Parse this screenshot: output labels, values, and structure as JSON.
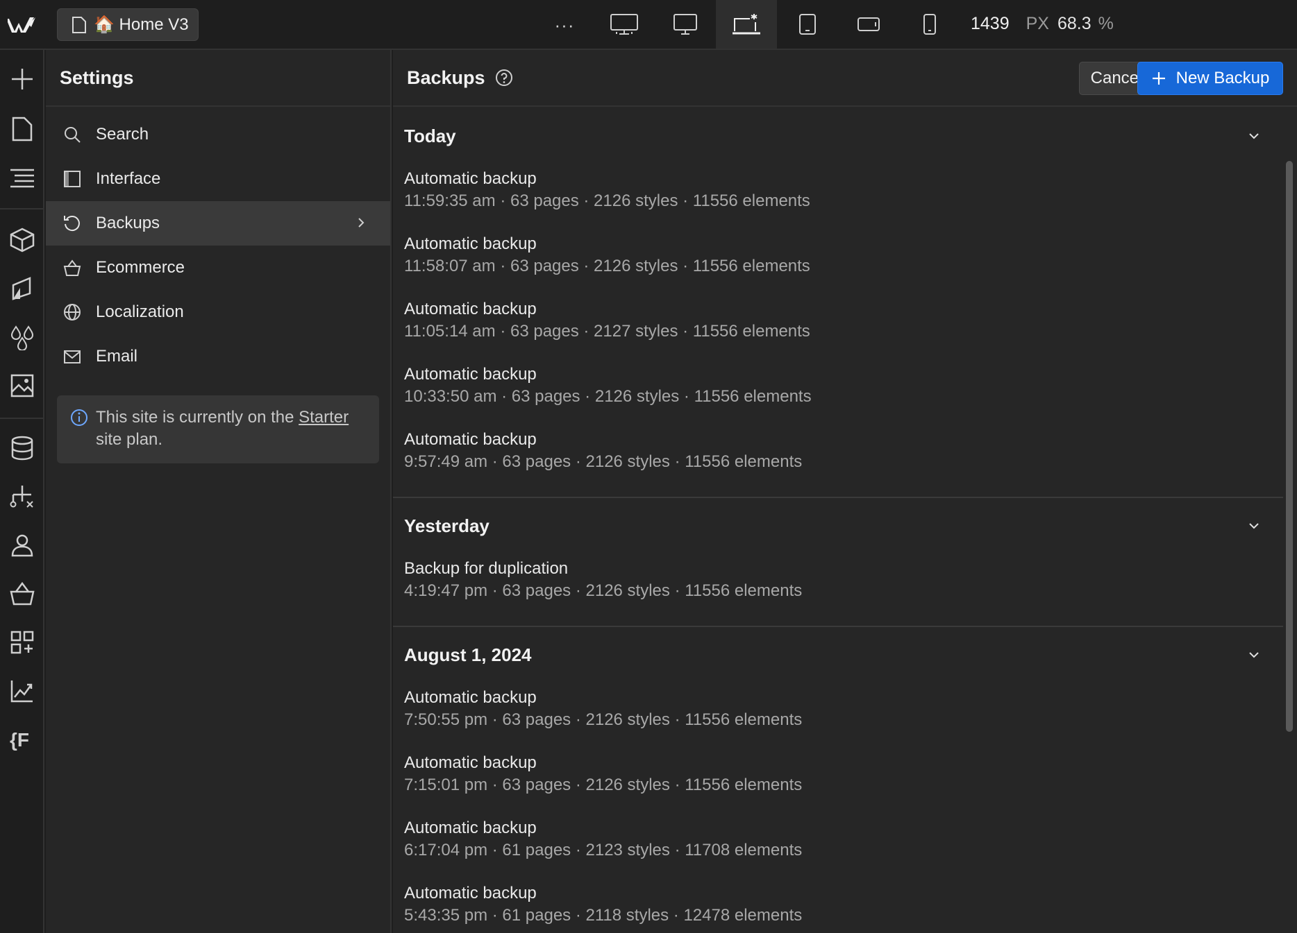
{
  "topbar": {
    "page_name": "🏠 Home V3",
    "more_label": "···",
    "width_value": "1439",
    "width_unit": "PX",
    "zoom_value": "68.3",
    "zoom_unit": "%"
  },
  "settings": {
    "title": "Settings",
    "nav": [
      {
        "label": "Search",
        "icon": "search-icon"
      },
      {
        "label": "Interface",
        "icon": "interface-icon"
      },
      {
        "label": "Backups",
        "icon": "backup-icon"
      },
      {
        "label": "Ecommerce",
        "icon": "basket-icon"
      },
      {
        "label": "Localization",
        "icon": "globe-icon"
      },
      {
        "label": "Email",
        "icon": "mail-icon"
      }
    ],
    "active_item": "Backups",
    "plan_text_before": "This site is currently on the ",
    "plan_link": "Starter",
    "plan_text_after": " site plan."
  },
  "backups": {
    "title": "Backups",
    "cancel_label": "Cancel",
    "new_label": "New Backup",
    "groups": [
      {
        "title": "Today",
        "entries": [
          {
            "name": "Automatic backup",
            "meta": "11:59:35 am · 63 pages · 2126 styles · 11556 elements"
          },
          {
            "name": "Automatic backup",
            "meta": "11:58:07 am · 63 pages · 2126 styles · 11556 elements"
          },
          {
            "name": "Automatic backup",
            "meta": "11:05:14 am · 63 pages · 2127 styles · 11556 elements"
          },
          {
            "name": "Automatic backup",
            "meta": "10:33:50 am · 63 pages · 2126 styles · 11556 elements"
          },
          {
            "name": "Automatic backup",
            "meta": "9:57:49 am · 63 pages · 2126 styles · 11556 elements"
          }
        ]
      },
      {
        "title": "Yesterday",
        "entries": [
          {
            "name": "Backup for duplication",
            "meta": "4:19:47 pm · 63 pages · 2126 styles · 11556 elements"
          }
        ]
      },
      {
        "title": "August 1, 2024",
        "entries": [
          {
            "name": "Automatic backup",
            "meta": "7:50:55 pm · 63 pages · 2126 styles · 11556 elements"
          },
          {
            "name": "Automatic backup",
            "meta": "7:15:01 pm · 63 pages · 2126 styles · 11556 elements"
          },
          {
            "name": "Automatic backup",
            "meta": "6:17:04 pm · 61 pages · 2123 styles · 11708 elements"
          },
          {
            "name": "Automatic backup",
            "meta": "5:43:35 pm · 61 pages · 2118 styles · 12478 elements"
          }
        ]
      }
    ]
  },
  "colors": {
    "background": "#1e1e1e",
    "panel": "#262626",
    "active_item": "#3a3a3a",
    "primary_button": "#1768d8"
  }
}
